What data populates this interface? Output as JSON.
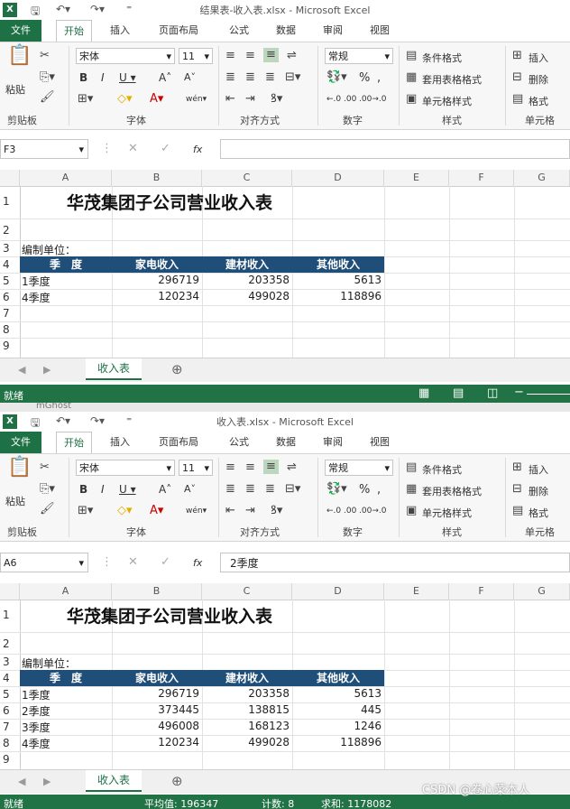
{
  "windows": [
    {
      "title": "结果表-收入表.xlsx - Microsoft Excel",
      "name_box": "F3",
      "formula": "",
      "sheet_tab": "收入表",
      "status_left": "就绪",
      "status_stats": null,
      "rows": [
        {
          "num": "1",
          "a": "",
          "b": "",
          "c": "",
          "d": ""
        },
        {
          "num": "2",
          "a": "",
          "b": "",
          "c": "",
          "d": ""
        },
        {
          "num": "3",
          "a": "编制单位：",
          "b": "",
          "c": "",
          "d": ""
        },
        {
          "num": "4",
          "a": "季　度",
          "b": "家电收入",
          "c": "建材收入",
          "d": "其他收入"
        },
        {
          "num": "5",
          "a": "1季度",
          "b": "296719",
          "c": "203358",
          "d": "5613"
        },
        {
          "num": "6",
          "a": "4季度",
          "b": "120234",
          "c": "499028",
          "d": "118896"
        },
        {
          "num": "7",
          "a": "",
          "b": "",
          "c": "",
          "d": ""
        },
        {
          "num": "8",
          "a": "",
          "b": "",
          "c": "",
          "d": ""
        },
        {
          "num": "9",
          "a": "",
          "b": "",
          "c": "",
          "d": ""
        }
      ]
    },
    {
      "title": "收入表.xlsx - Microsoft Excel",
      "name_box": "A6",
      "formula": "2季度",
      "sheet_tab": "收入表",
      "status_left": "就绪",
      "status_stats": {
        "avg": "平均值: 196347",
        "count": "计数: 8",
        "sum": "求和: 1178082"
      },
      "rows": [
        {
          "num": "1",
          "a": "",
          "b": "",
          "c": "",
          "d": ""
        },
        {
          "num": "2",
          "a": "",
          "b": "",
          "c": "",
          "d": ""
        },
        {
          "num": "3",
          "a": "编制单位：",
          "b": "",
          "c": "",
          "d": ""
        },
        {
          "num": "4",
          "a": "季　度",
          "b": "家电收入",
          "c": "建材收入",
          "d": "其他收入"
        },
        {
          "num": "5",
          "a": "1季度",
          "b": "296719",
          "c": "203358",
          "d": "5613"
        },
        {
          "num": "6",
          "a": "2季度",
          "b": "373445",
          "c": "138815",
          "d": "445"
        },
        {
          "num": "7",
          "a": "3季度",
          "b": "496008",
          "c": "168123",
          "d": "1246"
        },
        {
          "num": "8",
          "a": "4季度",
          "b": "120234",
          "c": "499028",
          "d": "118896"
        },
        {
          "num": "9",
          "a": "",
          "b": "",
          "c": "",
          "d": ""
        }
      ]
    }
  ],
  "sheet_title": "华茂集团子公司营业收入表",
  "tabs": {
    "file": "文件",
    "home": "开始",
    "insert": "插入",
    "layout": "页面布局",
    "formulas": "公式",
    "data": "数据",
    "review": "审阅",
    "view": "视图"
  },
  "ribbon": {
    "paste": "粘贴",
    "clipboard": "剪贴板",
    "font_name": "宋体",
    "font_size": "11",
    "font_group": "字体",
    "align_group": "对齐方式",
    "number_format": "常规",
    "number_group": "数字",
    "cond_format": "条件格式",
    "table_format": "套用表格格式",
    "cell_style": "单元格样式",
    "style_group": "样式",
    "insert": "插入",
    "delete": "删除",
    "format": "格式",
    "cells_group": "单元格"
  },
  "columns": [
    "A",
    "B",
    "C",
    "D",
    "E",
    "F",
    "G"
  ],
  "fx": "fx",
  "ghost_text": "mGhost",
  "watermark": "CSDN @卷心菜本人",
  "colors": {
    "excel_green": "#217346",
    "header_blue": "#1f4e79"
  }
}
